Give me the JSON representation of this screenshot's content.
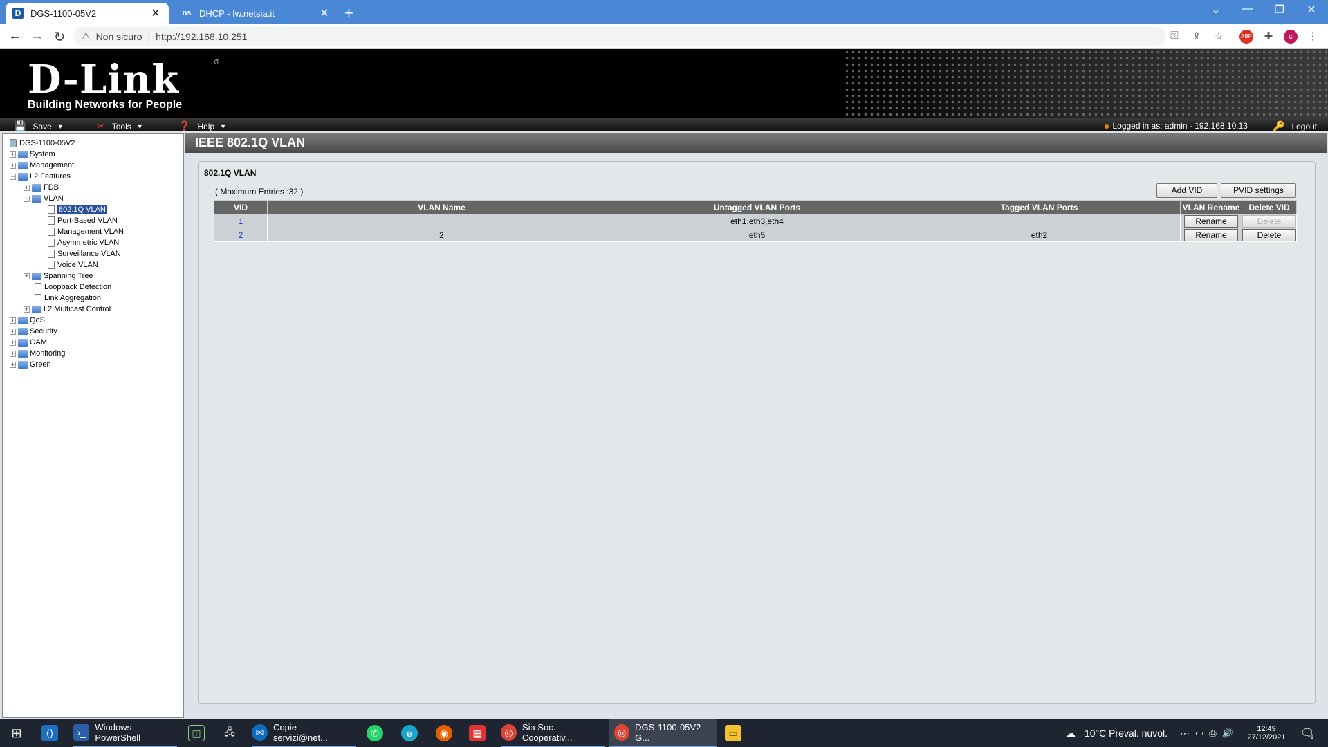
{
  "browser": {
    "tabs": [
      {
        "title": "DGS-1100-05V2",
        "favicon": "D"
      },
      {
        "title": "DHCP - fw.netsia.it",
        "favicon": "ns"
      }
    ],
    "security_label": "Non sicuro",
    "url": "http://192.168.10.251",
    "profile_initial": "c"
  },
  "app": {
    "logo_brand": "D-Link",
    "logo_reg": "®",
    "logo_tagline": "Building Networks for People",
    "menu": {
      "save": "Save",
      "tools": "Tools",
      "help": "Help"
    },
    "logged_in": "Logged in as: admin - 192.168.10.13",
    "logout": "Logout"
  },
  "tree": [
    {
      "label": "DGS-1100-05V2"
    },
    {
      "label": "System"
    },
    {
      "label": "Management"
    },
    {
      "label": "L2 Features"
    },
    {
      "label": "FDB"
    },
    {
      "label": "VLAN"
    },
    {
      "label": "802.1Q VLAN"
    },
    {
      "label": "Port-Based VLAN"
    },
    {
      "label": "Management VLAN"
    },
    {
      "label": "Asymmetric VLAN"
    },
    {
      "label": "Surveillance VLAN"
    },
    {
      "label": "Voice VLAN"
    },
    {
      "label": "Spanning Tree"
    },
    {
      "label": "Loopback Detection"
    },
    {
      "label": "Link Aggregation"
    },
    {
      "label": "L2 Multicast Control"
    },
    {
      "label": "QoS"
    },
    {
      "label": "Security"
    },
    {
      "label": "OAM"
    },
    {
      "label": "Monitoring"
    },
    {
      "label": "Green"
    }
  ],
  "content": {
    "page_title": "IEEE 802.1Q VLAN",
    "panel_title": "802.1Q VLAN",
    "max_entries": "( Maximum Entries :32 )",
    "add_vid": "Add VID",
    "pvid_settings": "PVID settings",
    "columns": [
      "VID",
      "VLAN Name",
      "Untagged VLAN Ports",
      "Tagged VLAN Ports",
      "VLAN Rename",
      "Delete VID"
    ],
    "rows": [
      {
        "vid": "1",
        "name": "",
        "untagged": "eth1,eth3,eth4",
        "tagged": "",
        "rename": "Rename",
        "delete": "Delete",
        "delete_enabled": false
      },
      {
        "vid": "2",
        "name": "2",
        "untagged": "eth5",
        "tagged": "eth2",
        "rename": "Rename",
        "delete": "Delete",
        "delete_enabled": true
      }
    ]
  },
  "taskbar": {
    "items": [
      {
        "label": "Windows PowerShell"
      },
      {
        "label": "Copie - servizi@net..."
      },
      {
        "label": "Sia Soc. Cooperativ..."
      },
      {
        "label": "DGS-1100-05V2 - G..."
      }
    ],
    "weather": "10°C  Preval. nuvol.",
    "time": "12:49",
    "date": "27/12/2021",
    "notification_count": "1"
  },
  "colors": {
    "tabstrip": "#4a88d6",
    "header_bar": "#4a4a4a",
    "link": "#1a3ad0",
    "selected_tree": "#2a4fa0"
  }
}
